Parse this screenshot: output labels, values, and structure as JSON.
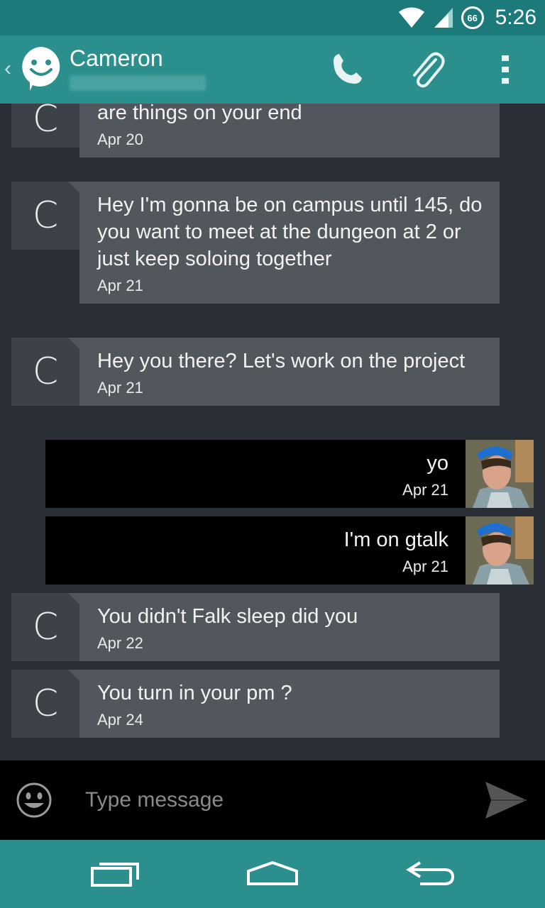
{
  "status_bar": {
    "time": "5:26",
    "battery_level": "66"
  },
  "action_bar": {
    "contact_name": "Cameron"
  },
  "messages": [
    {
      "direction": "in",
      "avatar_letter": "C",
      "text": "Irrigation surround checking works. How are things on your end",
      "date": "Apr 20"
    },
    {
      "direction": "in",
      "avatar_letter": "C",
      "text": "Hey I'm gonna be on campus until 145, do you want to meet at the dungeon at 2 or just keep soloing together",
      "date": "Apr 21"
    },
    {
      "direction": "in",
      "avatar_letter": "C",
      "text": "Hey you there? Let's work on the project",
      "date": "Apr 21"
    },
    {
      "direction": "out",
      "text": "yo",
      "date": "Apr 21"
    },
    {
      "direction": "out",
      "text": "I'm on gtalk",
      "date": "Apr 21"
    },
    {
      "direction": "in",
      "avatar_letter": "C",
      "text": "You didn't Falk sleep did you",
      "date": "Apr 22"
    },
    {
      "direction": "in",
      "avatar_letter": "C",
      "text": "You turn in your pm ?",
      "date": "Apr 24"
    }
  ],
  "composer": {
    "placeholder": "Type message",
    "value": ""
  },
  "icons": {
    "back": "chevron-left-icon",
    "app": "smiley-chat-icon",
    "call": "phone-icon",
    "attach": "paperclip-icon",
    "overflow": "more-vertical-icon",
    "emoji": "emoji-icon",
    "send": "send-icon",
    "recents": "recent-apps-icon",
    "home": "home-icon",
    "nav_back": "back-icon"
  },
  "colors": {
    "status_bar": "#1d7a7a",
    "action_bar": "#2a8f8d",
    "background": "#2a2e36",
    "incoming_bubble": "#52575d",
    "incoming_avatar": "#3d4249",
    "outgoing_bubble": "#000000"
  }
}
